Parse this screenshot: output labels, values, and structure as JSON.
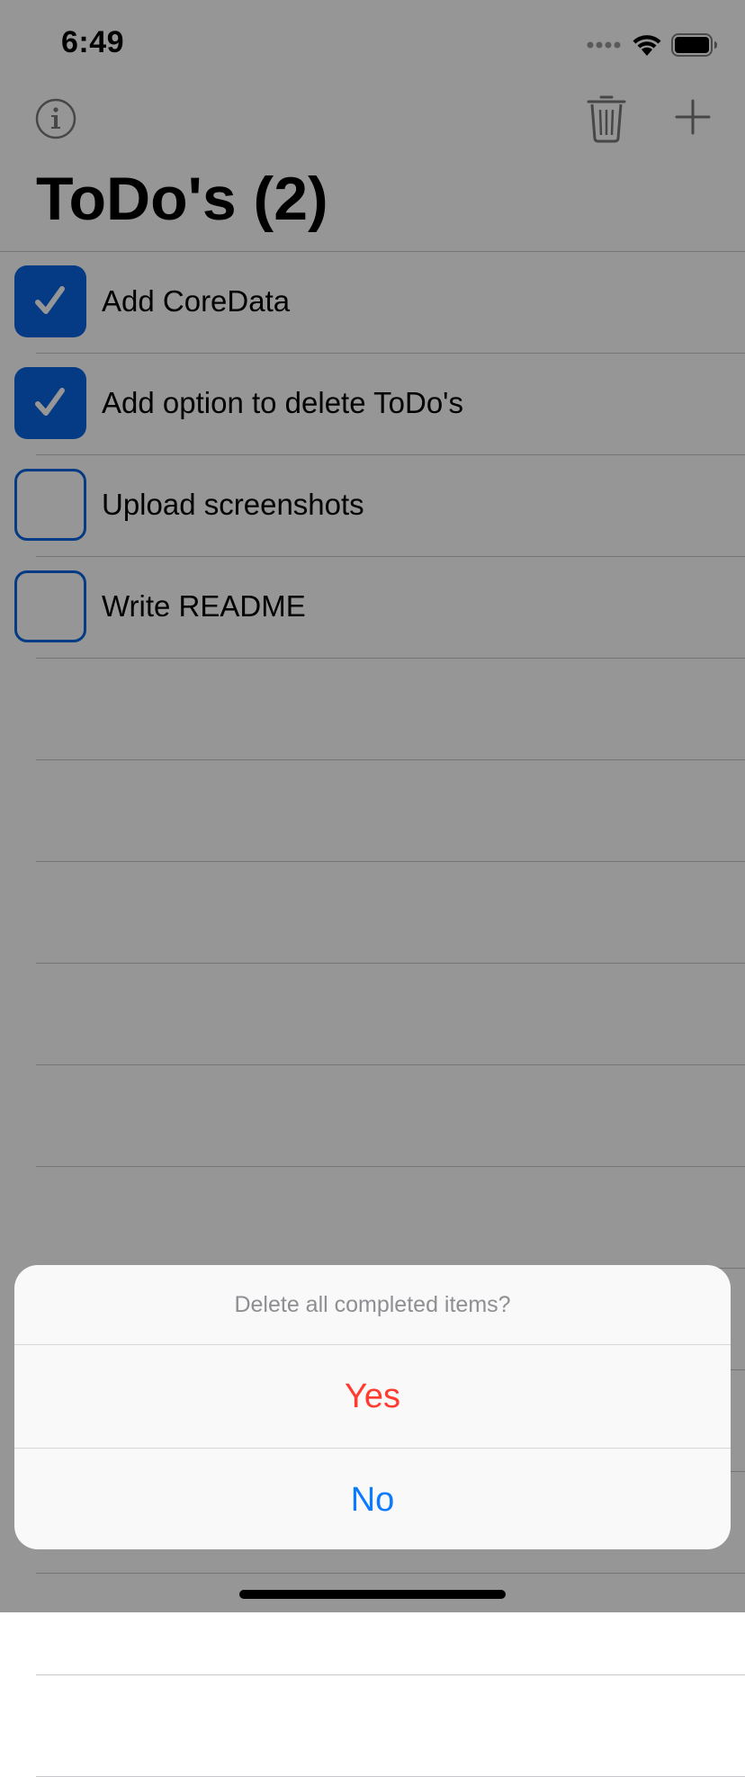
{
  "status_bar": {
    "time": "6:49",
    "icons": [
      "signal-icon",
      "wifi-icon",
      "battery-icon"
    ]
  },
  "nav": {
    "info_icon": "info-icon",
    "trash_icon": "trash-icon",
    "add_icon": "plus-icon",
    "title": "ToDo's (2)"
  },
  "todos": [
    {
      "label": "Add CoreData",
      "completed": true
    },
    {
      "label": "Add option to delete ToDo's",
      "completed": true
    },
    {
      "label": "Upload screenshots",
      "completed": false
    },
    {
      "label": "Write README",
      "completed": false
    }
  ],
  "action_sheet": {
    "title": "Delete all completed items?",
    "yes_label": "Yes",
    "no_label": "No"
  },
  "colors": {
    "accent": "#0a64e0",
    "destructive": "#ff3b30",
    "default_action": "#0a7aff",
    "overlay": "rgba(0,0,0,0.41)"
  }
}
